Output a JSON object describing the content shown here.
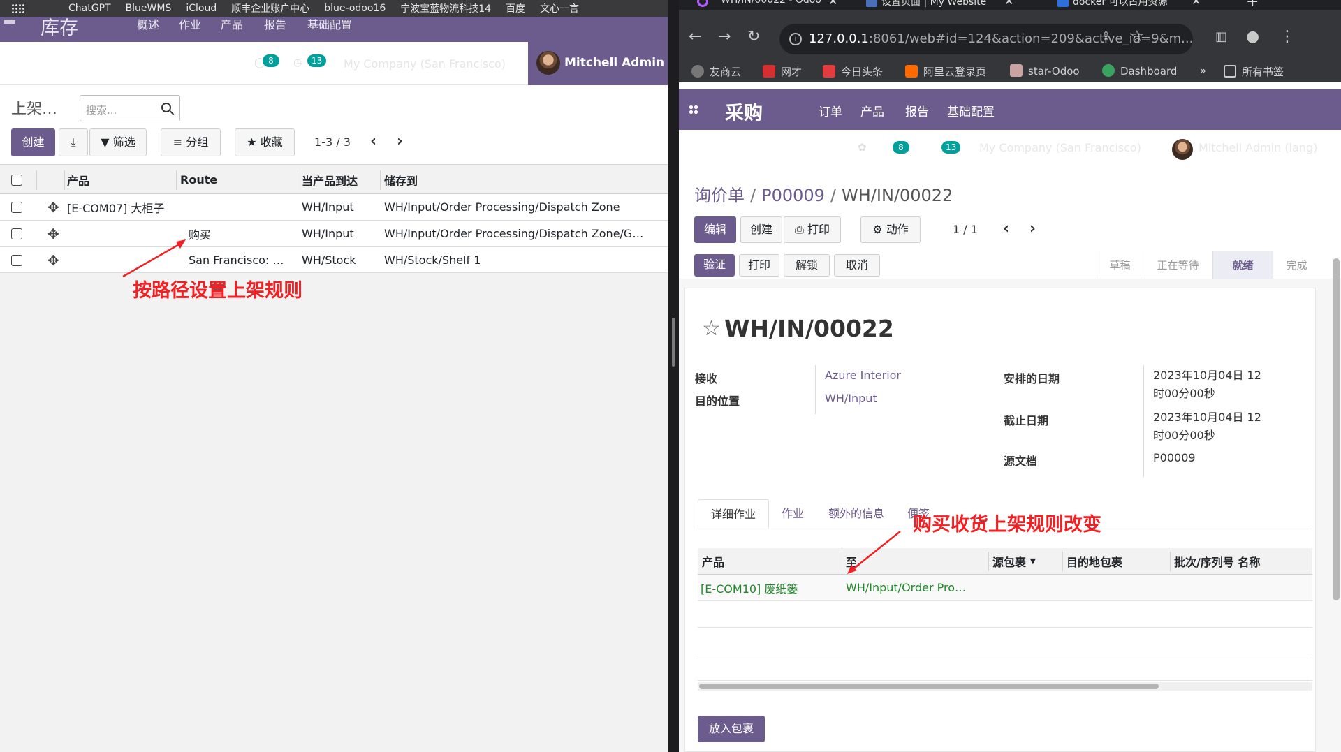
{
  "left": {
    "bookmarks": [
      "ChatGPT",
      "BlueWMS",
      "iCloud",
      "顺丰企业账户中心",
      "blue-odoo16",
      "宁波宝蓝物流科技14",
      "百度",
      "文心一言"
    ],
    "nav": {
      "title": "库存",
      "menu": [
        "概述",
        "作业",
        "产品",
        "报告",
        "基础配置"
      ]
    },
    "status": {
      "messages_count": "8",
      "activity_count": "13",
      "company": "My Company (San Francisco)",
      "user": "Mitchell Admin"
    },
    "control_panel": {
      "title": "上架…",
      "search_placeholder": "搜索...",
      "create_label": "创建",
      "filter_label": "筛选",
      "group_label": "分组",
      "favorite_label": "收藏",
      "pager": "1-3 / 3"
    },
    "table": {
      "columns": {
        "product": "产品",
        "route": "Route",
        "arrival": "当产品到达",
        "store": "储存到"
      },
      "rows": [
        {
          "product": "[E-COM07] 大柜子",
          "route": "",
          "arrival": "WH/Input",
          "store": "WH/Input/Order Processing/Dispatch Zone"
        },
        {
          "product": "",
          "route": "购买",
          "arrival": "WH/Input",
          "store": "WH/Input/Order Processing/Dispatch Zone/G…"
        },
        {
          "product": "",
          "route": "San Francisco: …",
          "arrival": "WH/Stock",
          "store": "WH/Stock/Shelf 1"
        }
      ]
    },
    "annotation": "按路径设置上架规则"
  },
  "right": {
    "tabs": [
      {
        "title": "WH/IN/00022 - Odoo"
      },
      {
        "title": "设置页面 | My Website"
      },
      {
        "title": "docker 可以占用资源"
      }
    ],
    "url_host": "127.0.0.1",
    "url_rest": ":8061/web#id=124&action=209&active_id=9&m...",
    "bookmarks": [
      "友商云",
      "网才",
      "今日头条",
      "阿里云登录页",
      "star-Odoo",
      "Dashboard",
      "所有书签"
    ],
    "bookmarks_more": "»",
    "nav": {
      "title": "采购",
      "menu": [
        "订单",
        "产品",
        "报告",
        "基础配置"
      ]
    },
    "status": {
      "messages_count": "8",
      "activity_count": "13",
      "company": "My Company (San Francisco)",
      "user": "Mitchell Admin (lang)"
    },
    "breadcrumb": {
      "root": "询价单",
      "parent": "P00009",
      "current": "WH/IN/00022"
    },
    "buttons": {
      "edit": "编辑",
      "create": "创建",
      "print": "打印",
      "action": "动作",
      "pager": "1 / 1"
    },
    "status_buttons": {
      "validate": "验证",
      "print": "打印",
      "unlock": "解锁",
      "cancel": "取消"
    },
    "stages": [
      {
        "label": "草稿",
        "active": false
      },
      {
        "label": "正在等待",
        "active": false
      },
      {
        "label": "就绪",
        "active": true
      },
      {
        "label": "完成",
        "active": false
      }
    ],
    "record": {
      "title": "WH/IN/00022",
      "receive_label": "接收",
      "receive_value": "Azure Interior",
      "dest_label": "目的位置",
      "dest_value": "WH/Input",
      "scheduled_label": "安排的日期",
      "scheduled_value_1": "2023年10月04日 12",
      "scheduled_value_2": "时00分00秒",
      "deadline_label": "截止日期",
      "deadline_value_1": "2023年10月04日 12",
      "deadline_value_2": "时00分00秒",
      "source_label": "源文档",
      "source_value": "P00009"
    },
    "notebook_tabs": [
      "详细作业",
      "作业",
      "额外的信息",
      "便签"
    ],
    "ops_table": {
      "columns": {
        "product": "产品",
        "to": "至",
        "src_pkg": "源包裹",
        "dst_pkg": "目的地包裹",
        "lot": "批次/序列号 名称"
      },
      "rows": [
        {
          "product": "[E-COM10] 废纸篓",
          "to": "WH/Input/Order Pro…"
        }
      ]
    },
    "put_in_pack": "放入包裹",
    "annotation": "购买收货上架规则改变"
  }
}
